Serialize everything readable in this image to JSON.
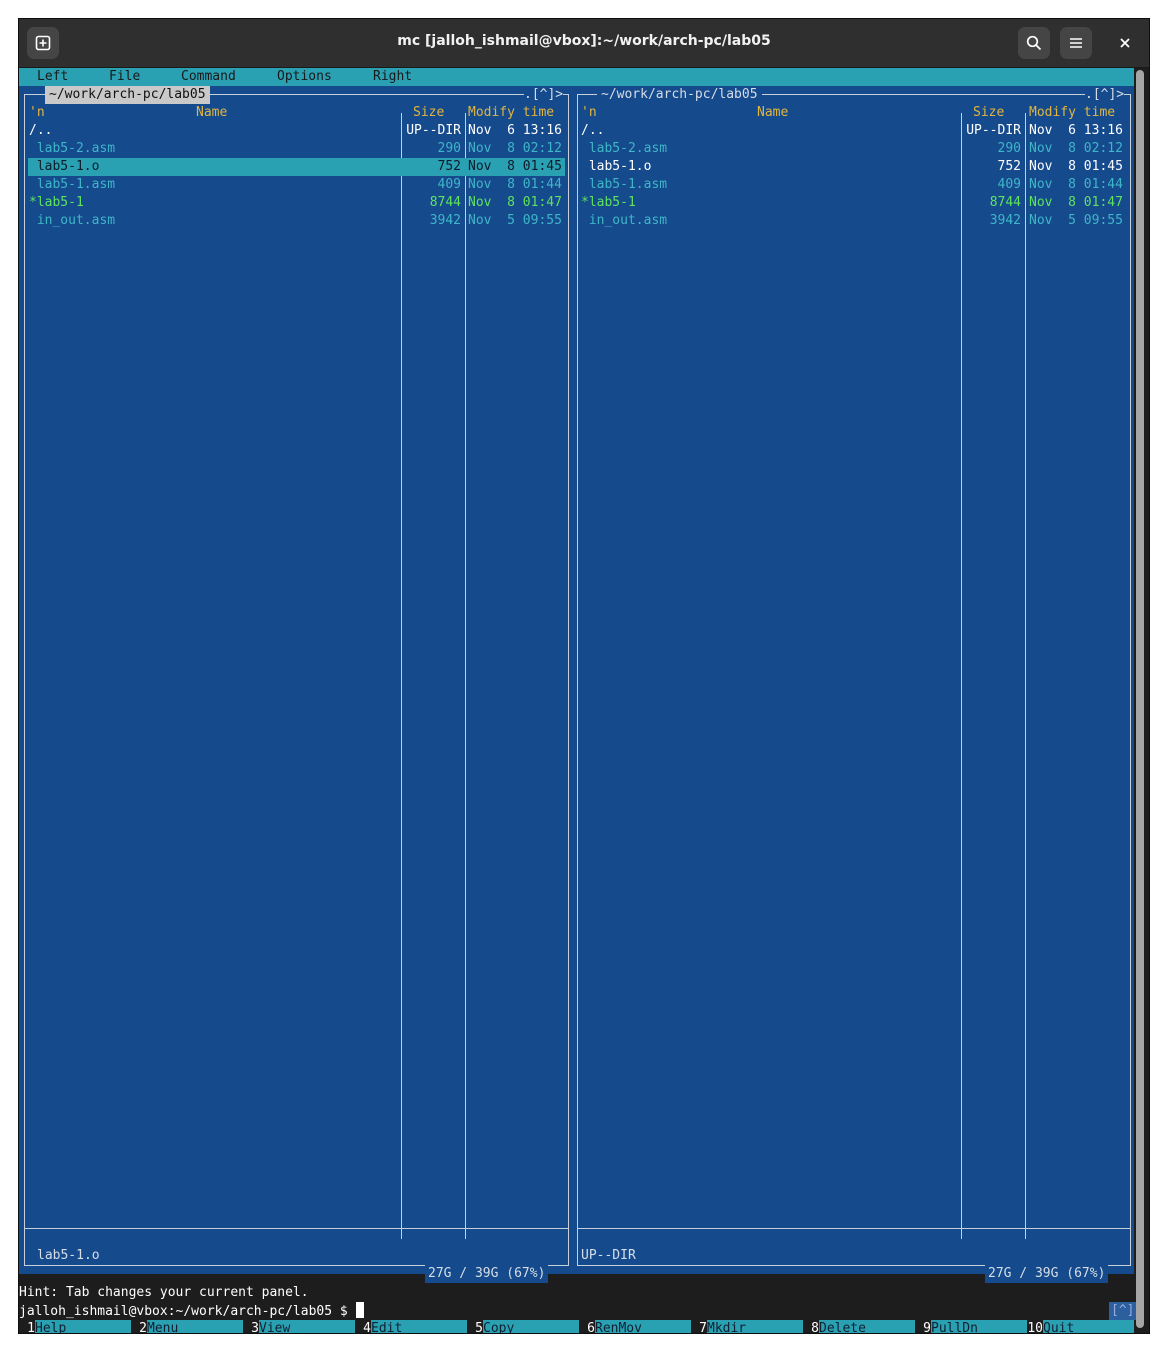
{
  "window": {
    "title": "mc [jalloh_ishmail@vbox]:~/work/arch-pc/lab05",
    "buttons": [
      "new-tab-icon",
      "search-icon",
      "hamburger-menu-icon",
      "close-icon"
    ]
  },
  "menu": {
    "items": [
      "Left",
      "File",
      "Command",
      "Options",
      "Right"
    ]
  },
  "left_panel": {
    "path": " ~/work/arch-pc/lab05 ",
    "corner": ".[^]>",
    "header": {
      "sort": "'n",
      "name": "Name",
      "size": "Size",
      "time": "Modify time"
    },
    "files": [
      {
        "name": "/..",
        "size": "UP--DIR",
        "date": "Nov  6 13:16",
        "kind": "dir"
      },
      {
        "name": " lab5-2.asm",
        "size": "290",
        "date": "Nov  8 02:12",
        "kind": "asm"
      },
      {
        "name": " lab5-1.o",
        "size": "752",
        "date": "Nov  8 01:45",
        "kind": "obj",
        "selected": true
      },
      {
        "name": " lab5-1.asm",
        "size": "409",
        "date": "Nov  8 01:44",
        "kind": "asm"
      },
      {
        "name": "*lab5-1",
        "size": "8744",
        "date": "Nov  8 01:47",
        "kind": "exe"
      },
      {
        "name": " in_out.asm",
        "size": "3942",
        "date": "Nov  5 09:55",
        "kind": "asm"
      }
    ],
    "mini_status": "lab5-1.o",
    "disk": "27G / 39G (67%)"
  },
  "right_panel": {
    "path": " ~/work/arch-pc/lab05 ",
    "corner": ".[^]>",
    "header": {
      "sort": "'n",
      "name": "Name",
      "size": "Size",
      "time": "Modify time"
    },
    "files": [
      {
        "name": "/..",
        "size": "UP--DIR",
        "date": "Nov  6 13:16",
        "kind": "dir"
      },
      {
        "name": " lab5-2.asm",
        "size": "290",
        "date": "Nov  8 02:12",
        "kind": "asm"
      },
      {
        "name": " lab5-1.o",
        "size": "752",
        "date": "Nov  8 01:45",
        "kind": "obj"
      },
      {
        "name": " lab5-1.asm",
        "size": "409",
        "date": "Nov  8 01:44",
        "kind": "asm"
      },
      {
        "name": "*lab5-1",
        "size": "8744",
        "date": "Nov  8 01:47",
        "kind": "exe"
      },
      {
        "name": " in_out.asm",
        "size": "3942",
        "date": "Nov  5 09:55",
        "kind": "asm"
      }
    ],
    "mini_status": "UP--DIR",
    "disk": "27G / 39G (67%)"
  },
  "hint": "Hint: Tab changes your current panel.",
  "prompt": "jalloh_ishmail@vbox:~/work/arch-pc/lab05 $ ",
  "indicator": "[^]",
  "fkeys": [
    {
      "num": "1",
      "label": "Help"
    },
    {
      "num": "2",
      "label": "Menu"
    },
    {
      "num": "3",
      "label": "View"
    },
    {
      "num": "4",
      "label": "Edit"
    },
    {
      "num": "5",
      "label": "Copy"
    },
    {
      "num": "6",
      "label": "RenMov"
    },
    {
      "num": "7",
      "label": "Mkdir"
    },
    {
      "num": "8",
      "label": "Delete"
    },
    {
      "num": "9",
      "label": "PullDn"
    },
    {
      "num": "10",
      "label": "Quit"
    }
  ]
}
